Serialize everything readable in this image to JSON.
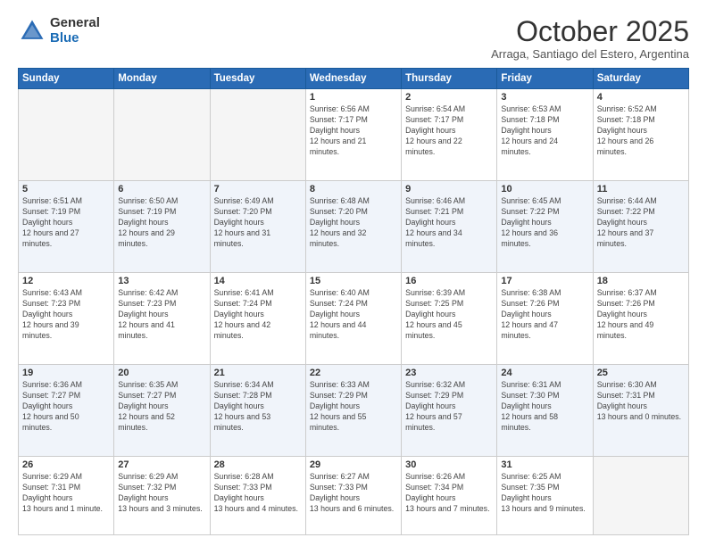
{
  "header": {
    "logo_general": "General",
    "logo_blue": "Blue",
    "month_title": "October 2025",
    "subtitle": "Arraga, Santiago del Estero, Argentina"
  },
  "calendar": {
    "days_of_week": [
      "Sunday",
      "Monday",
      "Tuesday",
      "Wednesday",
      "Thursday",
      "Friday",
      "Saturday"
    ],
    "weeks": [
      [
        {
          "day": "",
          "empty": true
        },
        {
          "day": "",
          "empty": true
        },
        {
          "day": "",
          "empty": true
        },
        {
          "day": "1",
          "sunrise": "6:56 AM",
          "sunset": "7:17 PM",
          "daylight": "12 hours and 21 minutes."
        },
        {
          "day": "2",
          "sunrise": "6:54 AM",
          "sunset": "7:17 PM",
          "daylight": "12 hours and 22 minutes."
        },
        {
          "day": "3",
          "sunrise": "6:53 AM",
          "sunset": "7:18 PM",
          "daylight": "12 hours and 24 minutes."
        },
        {
          "day": "4",
          "sunrise": "6:52 AM",
          "sunset": "7:18 PM",
          "daylight": "12 hours and 26 minutes."
        }
      ],
      [
        {
          "day": "5",
          "sunrise": "6:51 AM",
          "sunset": "7:19 PM",
          "daylight": "12 hours and 27 minutes."
        },
        {
          "day": "6",
          "sunrise": "6:50 AM",
          "sunset": "7:19 PM",
          "daylight": "12 hours and 29 minutes."
        },
        {
          "day": "7",
          "sunrise": "6:49 AM",
          "sunset": "7:20 PM",
          "daylight": "12 hours and 31 minutes."
        },
        {
          "day": "8",
          "sunrise": "6:48 AM",
          "sunset": "7:20 PM",
          "daylight": "12 hours and 32 minutes."
        },
        {
          "day": "9",
          "sunrise": "6:46 AM",
          "sunset": "7:21 PM",
          "daylight": "12 hours and 34 minutes."
        },
        {
          "day": "10",
          "sunrise": "6:45 AM",
          "sunset": "7:22 PM",
          "daylight": "12 hours and 36 minutes."
        },
        {
          "day": "11",
          "sunrise": "6:44 AM",
          "sunset": "7:22 PM",
          "daylight": "12 hours and 37 minutes."
        }
      ],
      [
        {
          "day": "12",
          "sunrise": "6:43 AM",
          "sunset": "7:23 PM",
          "daylight": "12 hours and 39 minutes."
        },
        {
          "day": "13",
          "sunrise": "6:42 AM",
          "sunset": "7:23 PM",
          "daylight": "12 hours and 41 minutes."
        },
        {
          "day": "14",
          "sunrise": "6:41 AM",
          "sunset": "7:24 PM",
          "daylight": "12 hours and 42 minutes."
        },
        {
          "day": "15",
          "sunrise": "6:40 AM",
          "sunset": "7:24 PM",
          "daylight": "12 hours and 44 minutes."
        },
        {
          "day": "16",
          "sunrise": "6:39 AM",
          "sunset": "7:25 PM",
          "daylight": "12 hours and 45 minutes."
        },
        {
          "day": "17",
          "sunrise": "6:38 AM",
          "sunset": "7:26 PM",
          "daylight": "12 hours and 47 minutes."
        },
        {
          "day": "18",
          "sunrise": "6:37 AM",
          "sunset": "7:26 PM",
          "daylight": "12 hours and 49 minutes."
        }
      ],
      [
        {
          "day": "19",
          "sunrise": "6:36 AM",
          "sunset": "7:27 PM",
          "daylight": "12 hours and 50 minutes."
        },
        {
          "day": "20",
          "sunrise": "6:35 AM",
          "sunset": "7:27 PM",
          "daylight": "12 hours and 52 minutes."
        },
        {
          "day": "21",
          "sunrise": "6:34 AM",
          "sunset": "7:28 PM",
          "daylight": "12 hours and 53 minutes."
        },
        {
          "day": "22",
          "sunrise": "6:33 AM",
          "sunset": "7:29 PM",
          "daylight": "12 hours and 55 minutes."
        },
        {
          "day": "23",
          "sunrise": "6:32 AM",
          "sunset": "7:29 PM",
          "daylight": "12 hours and 57 minutes."
        },
        {
          "day": "24",
          "sunrise": "6:31 AM",
          "sunset": "7:30 PM",
          "daylight": "12 hours and 58 minutes."
        },
        {
          "day": "25",
          "sunrise": "6:30 AM",
          "sunset": "7:31 PM",
          "daylight": "13 hours and 0 minutes."
        }
      ],
      [
        {
          "day": "26",
          "sunrise": "6:29 AM",
          "sunset": "7:31 PM",
          "daylight": "13 hours and 1 minute."
        },
        {
          "day": "27",
          "sunrise": "6:29 AM",
          "sunset": "7:32 PM",
          "daylight": "13 hours and 3 minutes."
        },
        {
          "day": "28",
          "sunrise": "6:28 AM",
          "sunset": "7:33 PM",
          "daylight": "13 hours and 4 minutes."
        },
        {
          "day": "29",
          "sunrise": "6:27 AM",
          "sunset": "7:33 PM",
          "daylight": "13 hours and 6 minutes."
        },
        {
          "day": "30",
          "sunrise": "6:26 AM",
          "sunset": "7:34 PM",
          "daylight": "13 hours and 7 minutes."
        },
        {
          "day": "31",
          "sunrise": "6:25 AM",
          "sunset": "7:35 PM",
          "daylight": "13 hours and 9 minutes."
        },
        {
          "day": "",
          "empty": true
        }
      ]
    ]
  }
}
